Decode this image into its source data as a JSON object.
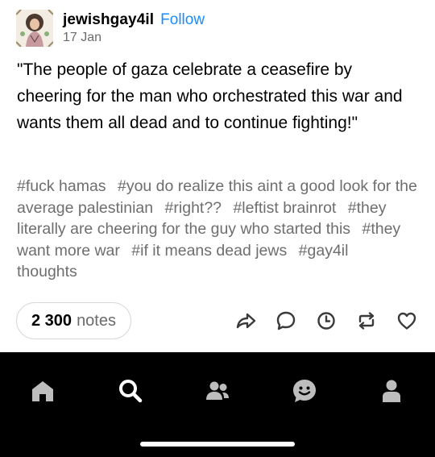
{
  "post": {
    "username": "jewishgay4il",
    "follow_label": "Follow",
    "date": "17 Jan",
    "body": "\"The people of gaza celebrate a ceasefire by cheering for the man who orchestrated this war and wants them all dead and to continue fighting!\"",
    "tags": [
      "#fuck hamas",
      "#you do realize this aint a good look for the average palestinian",
      "#right??",
      "#leftist brainrot",
      "#they literally are cheering for the guy who started this",
      "#they want more war",
      "#if it means dead jews",
      "#gay4il thoughts"
    ],
    "notes_count": "2 300",
    "notes_label": "notes"
  },
  "actions": [
    "share-icon",
    "reply-icon",
    "queue-icon",
    "reblog-icon",
    "like-icon"
  ],
  "tabbar": [
    "home-icon",
    "search-icon",
    "communities-icon",
    "activity-icon",
    "account-icon"
  ],
  "colors": {
    "accent": "#1a8cff",
    "tag_text": "#6e6e6e",
    "tabbar_bg": "#000000",
    "tabbar_icon": "#bdbdbd",
    "action_icon": "#3a3a3a"
  }
}
